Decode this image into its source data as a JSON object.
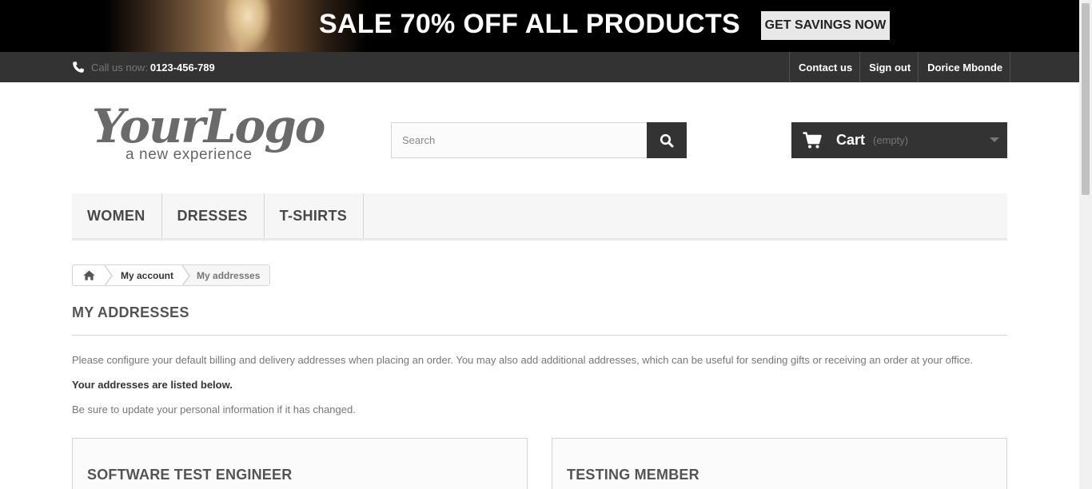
{
  "banner": {
    "headline": "SALE 70% OFF ALL PRODUCTS",
    "button_label": "GET SAVINGS NOW"
  },
  "topbar": {
    "call_label": "Call us now:",
    "phone_number": "0123-456-789",
    "links": [
      "Contact us",
      "Sign out",
      "Dorice Mbonde"
    ]
  },
  "header": {
    "logo_main": "YourLogo",
    "logo_tagline": "a new experience",
    "search_placeholder": "Search",
    "search_value": "",
    "cart_label": "Cart",
    "cart_status": "(empty)"
  },
  "menu": {
    "items": [
      "WOMEN",
      "DRESSES",
      "T-SHIRTS"
    ]
  },
  "breadcrumb": {
    "items": [
      "My account",
      "My addresses"
    ]
  },
  "page": {
    "title": "MY ADDRESSES",
    "intro": "Please configure your default billing and delivery addresses when placing an order. You may also add additional addresses, which can be useful for sending gifts or receiving an order at your office.",
    "listed_note": "Your addresses are listed below.",
    "update_note": "Be sure to update your personal information if it has changed."
  },
  "addresses": [
    {
      "title": "SOFTWARE TEST ENGINEER"
    },
    {
      "title": "TESTING MEMBER"
    }
  ],
  "icons": {
    "phone": "phone-icon",
    "search": "search-icon",
    "cart": "cart-icon",
    "home": "home-icon",
    "cart_dropdown": "chevron-down-icon"
  },
  "colors": {
    "dark_bar": "#333333",
    "menu_bg": "#f6f6f6",
    "border": "#d6d4d4",
    "text_muted": "#777777"
  }
}
